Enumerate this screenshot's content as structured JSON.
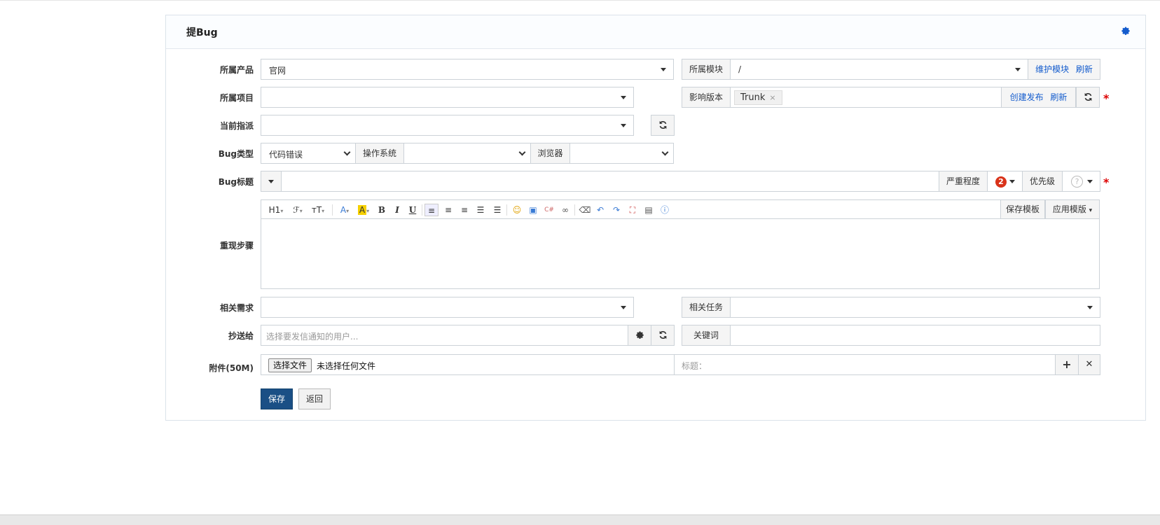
{
  "panel": {
    "title": "提Bug"
  },
  "form": {
    "product": {
      "label": "所属产品",
      "value": "官网"
    },
    "module": {
      "label": "所属模块",
      "value": "/",
      "maintain": "维护模块",
      "refresh": "刷新"
    },
    "project": {
      "label": "所属项目",
      "value": ""
    },
    "build": {
      "label": "影响版本",
      "tag": "Trunk",
      "tag_remove": "×",
      "create": "创建发布",
      "refresh": "刷新"
    },
    "assign": {
      "label": "当前指派",
      "value": ""
    },
    "type": {
      "label": "Bug类型",
      "value": "代码错误",
      "os_label": "操作系统",
      "os_value": "",
      "browser_label": "浏览器",
      "browser_value": ""
    },
    "title": {
      "label": "Bug标题",
      "value": "",
      "severity_label": "严重程度",
      "severity_value": "2",
      "pri_label": "优先级",
      "pri_value": "?"
    },
    "steps": {
      "label": "重现步骤",
      "save_template": "保存模板",
      "apply_template": "应用模版",
      "toolbar_h1": "H1",
      "toolbar_font": "ℱ",
      "toolbar_size": "тT",
      "toolbar_color": "A",
      "toolbar_bg": "A",
      "toolbar_bold": "B",
      "toolbar_italic": "I",
      "toolbar_underline": "U"
    },
    "story": {
      "label": "相关需求",
      "value": ""
    },
    "task": {
      "label": "相关任务",
      "value": ""
    },
    "cc": {
      "label": "抄送给",
      "placeholder": "选择要发信通知的用户..."
    },
    "keywords": {
      "label": "关键词",
      "value": ""
    },
    "files": {
      "label": "附件(50M)",
      "choose": "选择文件",
      "none": "未选择任何文件",
      "title_placeholder": "标题：",
      "add": "+",
      "remove": "✕"
    },
    "actions": {
      "save": "保存",
      "back": "返回"
    }
  },
  "colors": {
    "primary": "#1a4f85",
    "link": "#145ccd",
    "required": "#dd0000",
    "severity": "#d9331a"
  },
  "required_mark": "*"
}
